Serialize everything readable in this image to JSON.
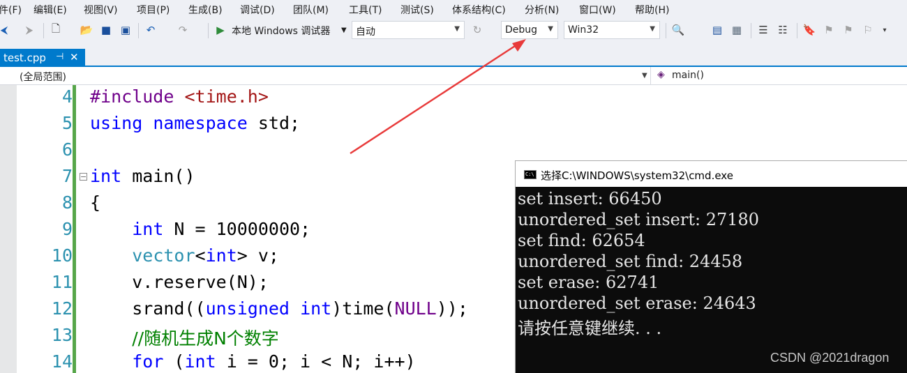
{
  "menu": [
    "件(F)",
    "编辑(E)",
    "视图(V)",
    "项目(P)",
    "生成(B)",
    "调试(D)",
    "团队(M)",
    "工具(T)",
    "测试(S)",
    "体系结构(C)",
    "分析(N)",
    "窗口(W)",
    "帮助(H)"
  ],
  "toolbar": {
    "run_label": "本地 Windows 调试器",
    "solution_config": "自动",
    "build_config": "Debug",
    "platform": "Win32"
  },
  "tab": {
    "filename": "test.cpp"
  },
  "navbar": {
    "scope": "(全局范围)",
    "function": "main()"
  },
  "editor": {
    "line_numbers": [
      "4",
      "5",
      "6",
      "7",
      "8",
      "9",
      "10",
      "11",
      "12",
      "13",
      "14"
    ]
  },
  "console": {
    "title": "选择C:\\WINDOWS\\system32\\cmd.exe",
    "lines": [
      "set insert: 66450",
      "unordered_set insert: 27180",
      "set find: 62654",
      "unordered_set find: 24458",
      "set erase: 62741",
      "unordered_set erase: 24643",
      "请按任意键继续. . ."
    ]
  },
  "watermark": "CSDN @2021dragon",
  "colors": {
    "accent": "#007acc",
    "annotation_arrow": "#e83a3a",
    "console_bg": "#0c0c0c",
    "change_bar": "#57a64a"
  }
}
